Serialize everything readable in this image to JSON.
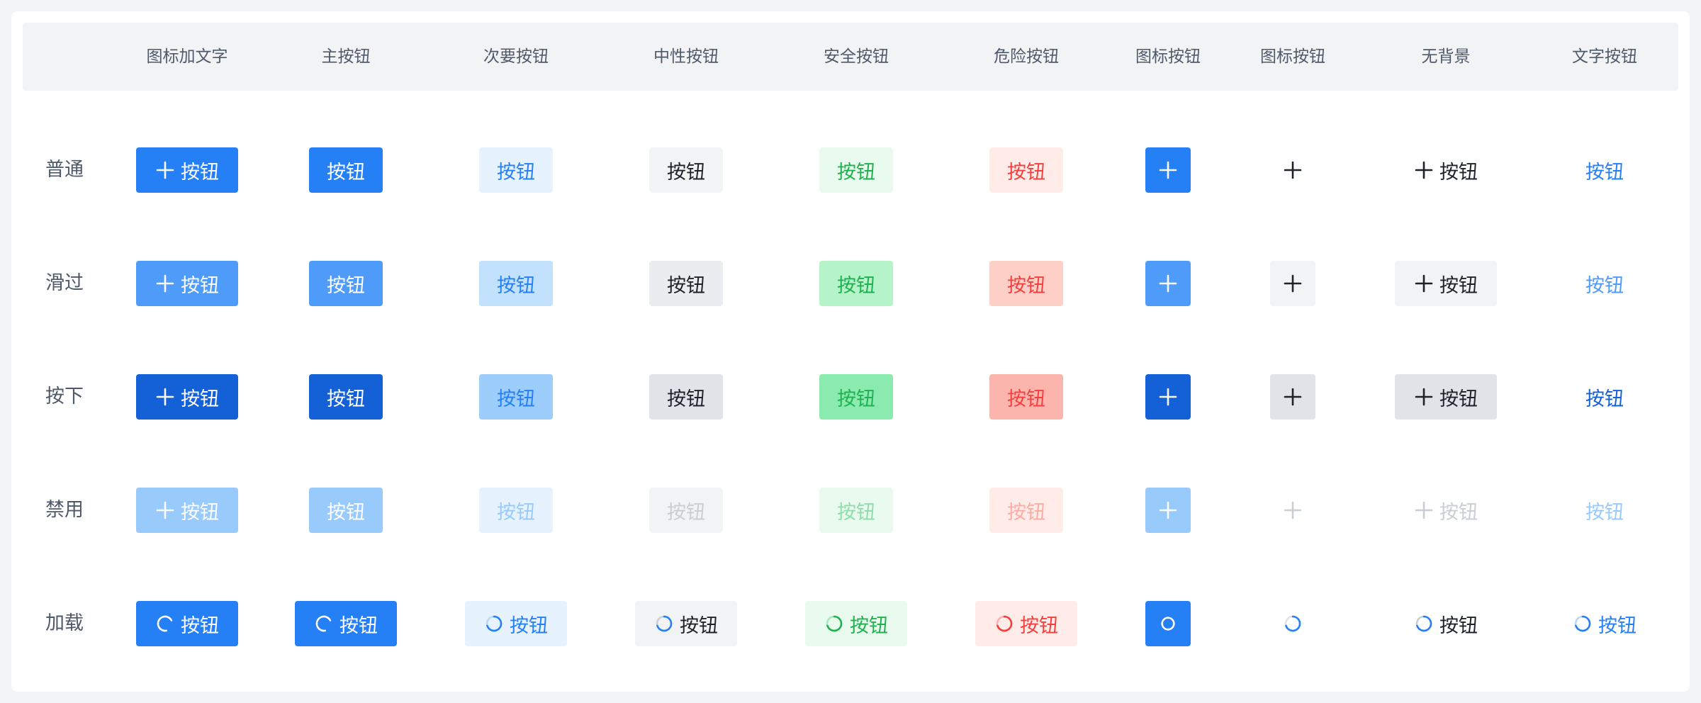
{
  "colors": {
    "primary": "#2680f5",
    "primary_hover": "#4f9bf9",
    "primary_active": "#1460d6",
    "primary_disabled": "#98cafc",
    "secondary_bg": "#e6f3fe",
    "secondary_hover": "#c1e1fd",
    "secondary_active": "#9ccdfb",
    "neutral_bg": "#f2f3f5",
    "neutral_hover": "#ebecef",
    "neutral_active": "#e1e3e8",
    "success_bg": "#e8fbee",
    "success_hover": "#b5f3c9",
    "success_active": "#8bebae",
    "success_text": "#1fb14f",
    "danger_bg": "#ffece8",
    "danger_hover": "#fdcfc6",
    "danger_active": "#fcb5ac",
    "danger_text": "#f53f3f",
    "text_dark": "#1d2129",
    "text_muted": "#4e5969",
    "text_disabled": "#c9cdd4"
  },
  "columns": [
    "",
    "图标加文字",
    "主按钮",
    "次要按钮",
    "中性按钮",
    "安全按钮",
    "危险按钮",
    "图标按钮",
    "图标按钮",
    "无背景",
    "文字按钮"
  ],
  "rows": [
    {
      "label": "普通"
    },
    {
      "label": "滑过"
    },
    {
      "label": "按下"
    },
    {
      "label": "禁用"
    },
    {
      "label": "加载"
    }
  ],
  "button_label": "按钮",
  "icons": {
    "plus": "plus-icon",
    "loading": "loading-spinner-icon"
  }
}
